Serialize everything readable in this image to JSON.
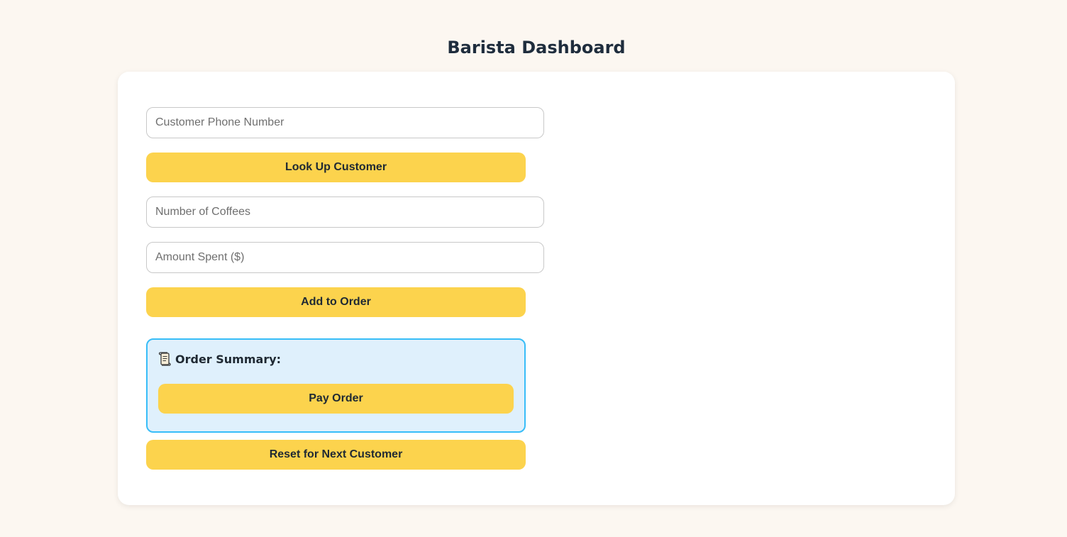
{
  "header": {
    "title": "Barista Dashboard"
  },
  "form": {
    "phone_placeholder": "Customer Phone Number",
    "lookup_label": "Look Up Customer",
    "coffees_placeholder": "Number of Coffees",
    "amount_placeholder": "Amount Spent ($)",
    "add_label": "Add to Order"
  },
  "summary": {
    "icon": "scroll-icon",
    "heading": "Order Summary:",
    "pay_label": "Pay Order"
  },
  "reset_label": "Reset for Next Customer",
  "colors": {
    "background": "#fcf7f1",
    "button": "#fcd34d",
    "summary_background": "#dff0fc",
    "summary_border": "#38bdf8",
    "title": "#1f2d3d"
  }
}
